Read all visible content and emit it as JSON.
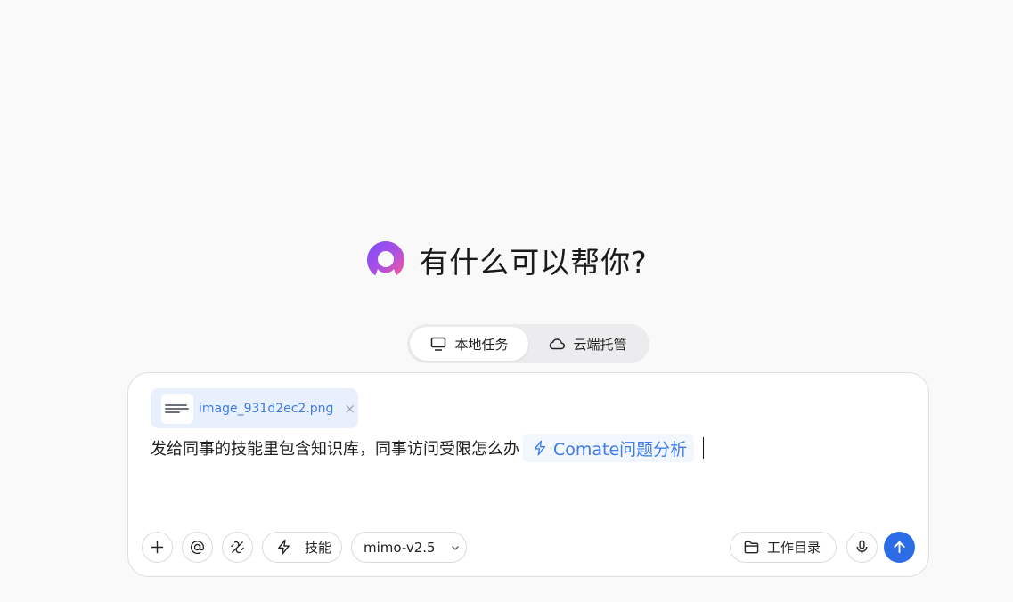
{
  "hero": {
    "title": "有什么可以帮你?"
  },
  "modes": [
    {
      "label": "本地任务",
      "icon": "monitor-icon",
      "active": true
    },
    {
      "label": "云端托管",
      "icon": "cloud-icon",
      "active": false
    }
  ],
  "attachment": {
    "filename": "image_931d2ec2.png",
    "close": "×"
  },
  "prompt": {
    "text": "发给同事的技能里包含知识库，同事访问受限怎么办",
    "skill_chip": "Comate问题分析"
  },
  "toolbar": {
    "skills_label": "技能",
    "model_label": "mimo-v2.5",
    "workdir_label": "工作目录"
  },
  "colors": {
    "accent": "#2c6de5",
    "chip_text": "#3d7be5",
    "chip_bg": "#e8f0fd"
  }
}
